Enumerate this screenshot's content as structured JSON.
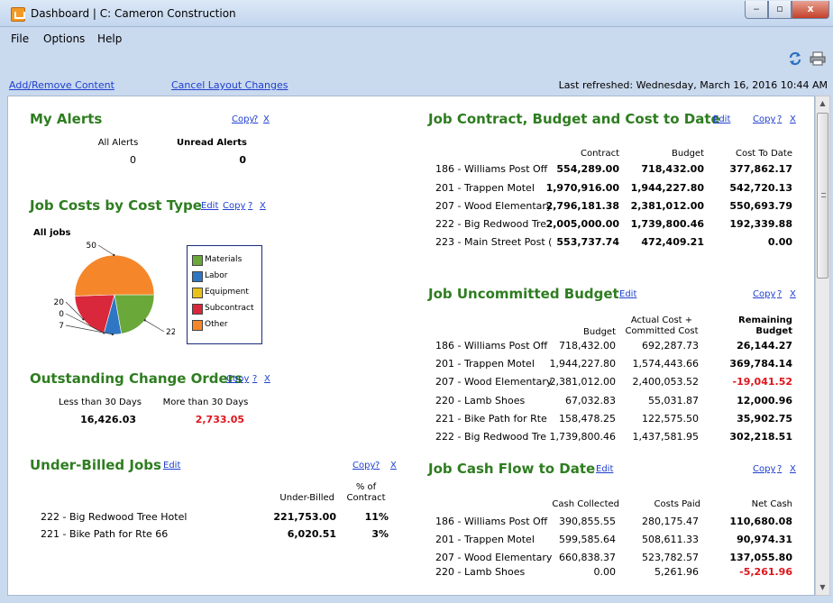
{
  "window": {
    "title": "Dashboard  |  C: Cameron Construction",
    "min_glyph": "‒",
    "max_glyph": "▫",
    "close_glyph": "x"
  },
  "menu": [
    "File",
    "Options",
    "Help"
  ],
  "actions": {
    "add_remove": "Add/Remove Content",
    "cancel_layout": "Cancel Layout Changes",
    "last_refreshed": "Last refreshed:  Wednesday, March 16, 2016  10:44 AM"
  },
  "widget_links": {
    "copy": "Copy",
    "help": "?",
    "close": "X",
    "edit": "Edit"
  },
  "alerts": {
    "title": "My Alerts",
    "all_label": "All Alerts",
    "unread_label": "Unread Alerts",
    "all_value": "0",
    "unread_value": "0"
  },
  "cost_type": {
    "title": "Job Costs by Cost Type",
    "subtitle": "All jobs"
  },
  "chart_data": {
    "type": "pie",
    "title": "",
    "slice_labels": [
      "50",
      "22",
      "7",
      "0",
      "20"
    ],
    "slices": [
      {
        "name": "Materials",
        "value": 22,
        "color": "#6ba83a"
      },
      {
        "name": "Labor",
        "value": 7,
        "color": "#2f76c4"
      },
      {
        "name": "Equipment",
        "value": 0,
        "color": "#e8c21c"
      },
      {
        "name": "Subcontract",
        "value": 20,
        "color": "#d9283b"
      },
      {
        "name": "Other",
        "value": 50,
        "color": "#f5872a"
      }
    ],
    "legend_placement": "right"
  },
  "change_orders": {
    "title": "Outstanding Change Orders",
    "lt30_label": "Less than 30 Days",
    "gt30_label": "More than 30 Days",
    "lt30_value": "16,426.03",
    "gt30_value": "2,733.05"
  },
  "underbilled": {
    "title": "Under-Billed Jobs",
    "col_under_billed": "Under-Billed",
    "col_pct_line1": "% of",
    "col_pct_line2": "Contract",
    "rows": [
      {
        "job": "222 - Big Redwood Tree Hotel",
        "amount": "221,753.00",
        "pct": "11%"
      },
      {
        "job": "221 - Bike Path for Rte 66",
        "amount": "6,020.51",
        "pct": "3%"
      }
    ]
  },
  "contract": {
    "title": "Job Contract, Budget and Cost to Date",
    "col_contract": "Contract",
    "col_budget": "Budget",
    "col_cost": "Cost To Date",
    "rows": [
      {
        "job": "186 - Williams Post Off",
        "contract": "554,289.00",
        "budget": "718,432.00",
        "cost": "377,862.17"
      },
      {
        "job": "201 - Trappen Motel",
        "contract": "1,970,916.00",
        "budget": "1,944,227.80",
        "cost": "542,720.13"
      },
      {
        "job": "207 - Wood Elementary",
        "contract": "2,796,181.38",
        "budget": "2,381,012.00",
        "cost": "550,693.79"
      },
      {
        "job": "222 - Big Redwood Tre",
        "contract": "2,005,000.00",
        "budget": "1,739,800.46",
        "cost": "192,339.88"
      },
      {
        "job": "223 - Main Street Post (",
        "contract": "553,737.74",
        "budget": "472,409.21",
        "cost": "0.00"
      }
    ]
  },
  "uncommitted": {
    "title": "Job Uncommitted Budget",
    "col_budget": "Budget",
    "col_actual_1": "Actual Cost +",
    "col_actual_2": "Committed Cost",
    "col_remaining_1": "Remaining",
    "col_remaining_2": "Budget",
    "rows": [
      {
        "job": "186 - Williams Post Off",
        "budget": "718,432.00",
        "actual": "692,287.73",
        "remaining": "26,144.27"
      },
      {
        "job": "201 - Trappen Motel",
        "budget": "1,944,227.80",
        "actual": "1,574,443.66",
        "remaining": "369,784.14"
      },
      {
        "job": "207 - Wood Elementary",
        "budget": "2,381,012.00",
        "actual": "2,400,053.52",
        "remaining": "-19,041.52"
      },
      {
        "job": "220 - Lamb Shoes",
        "budget": "67,032.83",
        "actual": "55,031.87",
        "remaining": "12,000.96"
      },
      {
        "job": "221 - Bike Path for Rte",
        "budget": "158,478.25",
        "actual": "122,575.50",
        "remaining": "35,902.75"
      },
      {
        "job": "222 - Big Redwood Tre",
        "budget": "1,739,800.46",
        "actual": "1,437,581.95",
        "remaining": "302,218.51"
      }
    ]
  },
  "cashflow": {
    "title": "Job Cash Flow to Date",
    "col_collected": "Cash Collected",
    "col_paid": "Costs Paid",
    "col_net": "Net Cash",
    "rows": [
      {
        "job": "186 - Williams Post Off",
        "collected": "390,855.55",
        "paid": "280,175.47",
        "net": "110,680.08"
      },
      {
        "job": "201 - Trappen Motel",
        "collected": "599,585.64",
        "paid": "508,611.33",
        "net": "90,974.31"
      },
      {
        "job": "207 - Wood Elementary",
        "collected": "660,838.37",
        "paid": "523,782.57",
        "net": "137,055.80"
      },
      {
        "job": "220 - Lamb Shoes",
        "collected": "0.00",
        "paid": "5,261.96",
        "net": "-5,261.96"
      }
    ]
  },
  "colors": {
    "title_green": "#2e7d20",
    "link_blue": "#1f3fd0",
    "negative_red": "#e0141b"
  }
}
